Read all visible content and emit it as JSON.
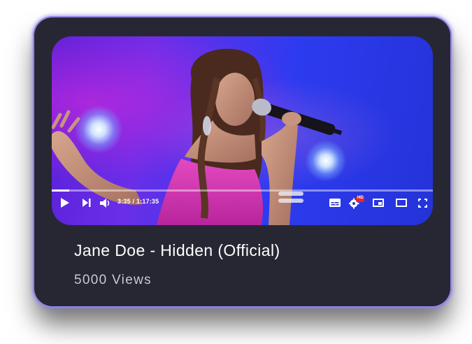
{
  "video": {
    "title": "Jane Doe - Hidden (Official)",
    "views": "5000 Views",
    "current_time": "3:35",
    "duration": "1:17:35",
    "time_display": "3:35 / 1:17:35",
    "progress": 0.046,
    "quality_badge": "HD"
  },
  "controls": {
    "icons": [
      "play-icon",
      "next-icon",
      "volume-icon",
      "subtitles-icon",
      "settings-icon",
      "miniplayer-icon",
      "theater-icon",
      "fullscreen-icon"
    ]
  },
  "colors": {
    "card_background": "#272734",
    "card_border": "#8f86e6",
    "badge_red": "#e5262b",
    "text_primary": "#ffffff",
    "text_secondary": "#c9c9d4"
  }
}
